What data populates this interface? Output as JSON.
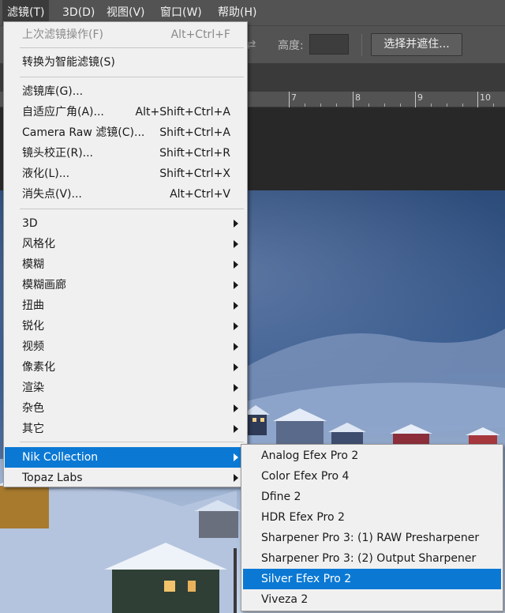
{
  "menubar": {
    "items": [
      {
        "label": "滤镜(T)"
      },
      {
        "label": "3D(D)"
      },
      {
        "label": "视图(V)"
      },
      {
        "label": "窗口(W)"
      },
      {
        "label": "帮助(H)"
      }
    ]
  },
  "options": {
    "height_label": "高度:",
    "height_value": "",
    "select_mask_button": "选择并遮住...",
    "swap_icon": "swap-arrows-icon"
  },
  "ruler": {
    "labels": [
      "7",
      "8",
      "9",
      "10"
    ]
  },
  "filter_menu": {
    "last_filter": {
      "label": "上次滤镜操作(F)",
      "shortcut": "Alt+Ctrl+F"
    },
    "convert_smart": {
      "label": "转换为智能滤镜(S)"
    },
    "gallery": {
      "label": "滤镜库(G)..."
    },
    "adaptive_wide": {
      "label": "自适应广角(A)...",
      "shortcut": "Alt+Shift+Ctrl+A"
    },
    "camera_raw": {
      "label": "Camera Raw 滤镜(C)...",
      "shortcut": "Shift+Ctrl+A"
    },
    "lens_correction": {
      "label": "镜头校正(R)...",
      "shortcut": "Shift+Ctrl+R"
    },
    "liquify": {
      "label": "液化(L)...",
      "shortcut": "Shift+Ctrl+X"
    },
    "vanishing_point": {
      "label": "消失点(V)...",
      "shortcut": "Alt+Ctrl+V"
    },
    "submenus": [
      {
        "label": "3D"
      },
      {
        "label": "风格化"
      },
      {
        "label": "模糊"
      },
      {
        "label": "模糊画廊"
      },
      {
        "label": "扭曲"
      },
      {
        "label": "锐化"
      },
      {
        "label": "视频"
      },
      {
        "label": "像素化"
      },
      {
        "label": "渲染"
      },
      {
        "label": "杂色"
      },
      {
        "label": "其它"
      }
    ],
    "plugins": [
      {
        "label": "Nik Collection"
      },
      {
        "label": "Topaz Labs"
      }
    ]
  },
  "nik_submenu": {
    "items": [
      {
        "label": "Analog Efex Pro 2"
      },
      {
        "label": "Color Efex Pro 4"
      },
      {
        "label": "Dfine 2"
      },
      {
        "label": "HDR Efex Pro 2"
      },
      {
        "label": "Sharpener Pro 3: (1) RAW Presharpener"
      },
      {
        "label": "Sharpener Pro 3: (2) Output Sharpener"
      },
      {
        "label": "Silver Efex Pro 2"
      },
      {
        "label": "Viveza 2"
      }
    ],
    "highlighted": "Silver Efex Pro 2"
  },
  "colors": {
    "highlight": "#0b79d4",
    "menu_bg": "#f0f0f0",
    "chrome": "#535353"
  }
}
